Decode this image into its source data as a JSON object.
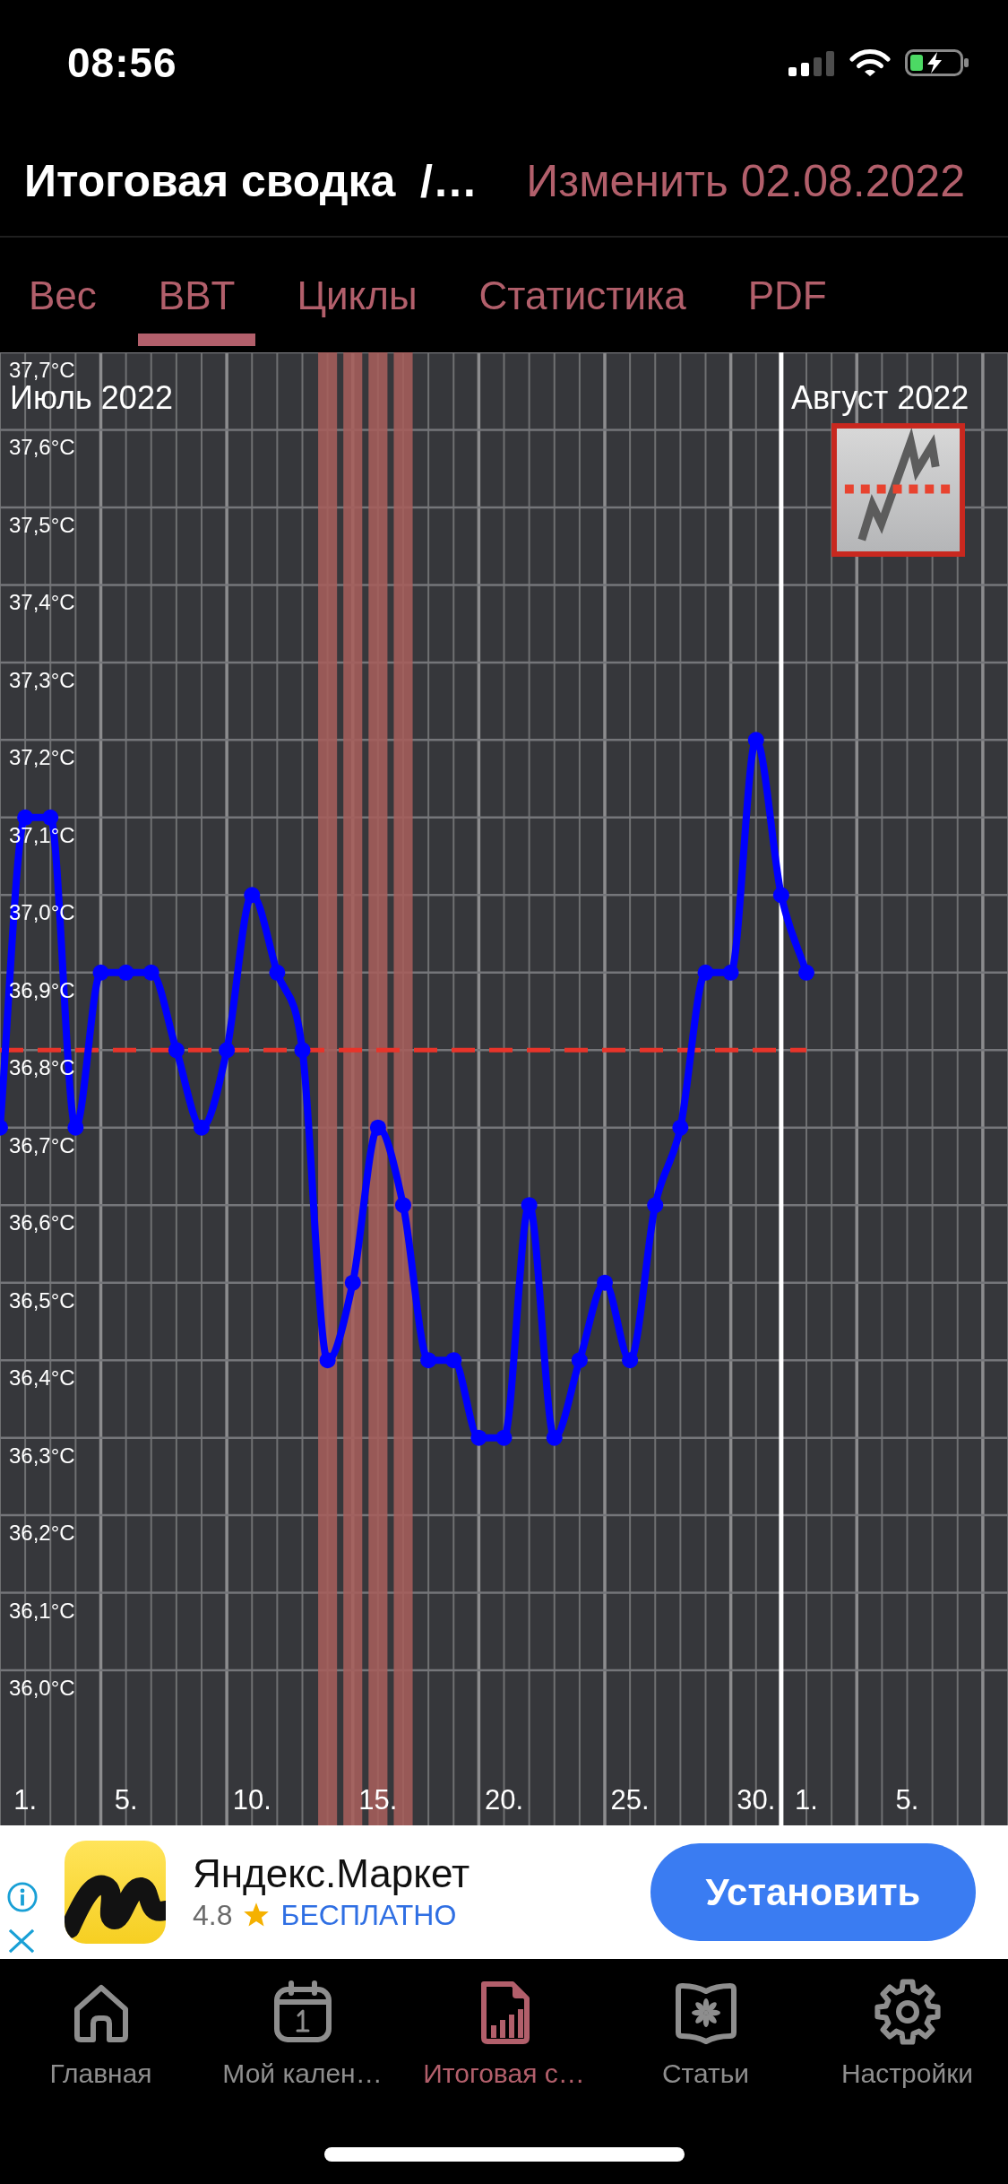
{
  "status_bar": {
    "time": "08:56"
  },
  "header": {
    "title": "Итоговая сводка  /…",
    "action": "Изменить 02.08.2022"
  },
  "tabs": [
    {
      "label": "Вес",
      "selected": false
    },
    {
      "label": "BBT",
      "selected": true
    },
    {
      "label": "Циклы",
      "selected": false
    },
    {
      "label": "Статистика",
      "selected": false
    },
    {
      "label": "PDF",
      "selected": false
    }
  ],
  "chart": {
    "chart_data": {
      "type": "line",
      "grid": true,
      "x": [
        "2022-06-30",
        "2022-07-01",
        "2022-07-02",
        "2022-07-03",
        "2022-07-04",
        "2022-07-05",
        "2022-07-06",
        "2022-07-07",
        "2022-07-08",
        "2022-07-09",
        "2022-07-10",
        "2022-07-11",
        "2022-07-12",
        "2022-07-13",
        "2022-07-14",
        "2022-07-15",
        "2022-07-16",
        "2022-07-17",
        "2022-07-18",
        "2022-07-19",
        "2022-07-20",
        "2022-07-21",
        "2022-07-22",
        "2022-07-23",
        "2022-07-24",
        "2022-07-25",
        "2022-07-26",
        "2022-07-27",
        "2022-07-28",
        "2022-07-29",
        "2022-07-30",
        "2022-07-31",
        "2022-08-01"
      ],
      "series": [
        {
          "color": "#0000ff",
          "marker": "circle",
          "values": [
            36.7,
            37.1,
            37.1,
            36.7,
            36.9,
            36.9,
            36.9,
            36.8,
            36.7,
            36.8,
            37.0,
            36.9,
            36.8,
            36.4,
            36.5,
            36.7,
            36.6,
            36.4,
            36.4,
            36.3,
            36.3,
            36.6,
            36.3,
            36.4,
            36.5,
            36.4,
            36.6,
            36.7,
            36.9,
            36.9,
            37.2,
            37.0,
            36.9
          ]
        }
      ],
      "xlim": [
        "2022-06-30",
        "2022-08-09"
      ],
      "ylim": [
        35.8,
        37.7
      ],
      "xticks": [
        {
          "value": "2022-07-01",
          "label": "1."
        },
        {
          "value": "2022-07-05",
          "label": "5."
        },
        {
          "value": "2022-07-10",
          "label": "10."
        },
        {
          "value": "2022-07-15",
          "label": "15."
        },
        {
          "value": "2022-07-20",
          "label": "20."
        },
        {
          "value": "2022-07-25",
          "label": "25."
        },
        {
          "value": "2022-07-30",
          "label": "30."
        },
        {
          "value": "2022-08-01",
          "label": "1."
        },
        {
          "value": "2022-08-05",
          "label": "5."
        }
      ],
      "yticks": [
        {
          "value": 36.0,
          "label": "36,0°C"
        },
        {
          "value": 36.1,
          "label": "36,1°C"
        },
        {
          "value": 36.2,
          "label": "36,2°C"
        },
        {
          "value": 36.3,
          "label": "36,3°C"
        },
        {
          "value": 36.4,
          "label": "36,4°C"
        },
        {
          "value": 36.5,
          "label": "36,5°C"
        },
        {
          "value": 36.6,
          "label": "36,6°C"
        },
        {
          "value": 36.7,
          "label": "36,7°C"
        },
        {
          "value": 36.8,
          "label": "36,8°C"
        },
        {
          "value": 36.9,
          "label": "36,9°C"
        },
        {
          "value": 37.0,
          "label": "37,0°C"
        },
        {
          "value": 37.1,
          "label": "37,1°C"
        },
        {
          "value": 37.2,
          "label": "37,2°C"
        },
        {
          "value": 37.3,
          "label": "37,3°C"
        },
        {
          "value": 37.4,
          "label": "37,4°C"
        },
        {
          "value": 37.5,
          "label": "37,5°C"
        },
        {
          "value": 37.6,
          "label": "37,6°C"
        },
        {
          "value": 37.7,
          "label": "37,7°C"
        }
      ],
      "bands": [
        {
          "axis": "x",
          "from": "2022-07-12T15:00",
          "to": "2022-07-13T09:00",
          "color": "#a65f5b"
        },
        {
          "axis": "x",
          "from": "2022-07-13T15:00",
          "to": "2022-07-14T09:00",
          "color": "#a65f5b"
        },
        {
          "axis": "x",
          "from": "2022-07-14T15:00",
          "to": "2022-07-15T09:00",
          "color": "#a65f5b"
        },
        {
          "axis": "x",
          "from": "2022-07-15T15:00",
          "to": "2022-07-16T09:00",
          "color": "#a65f5b"
        }
      ],
      "ref_lines": [
        {
          "axis": "y",
          "value": 36.8,
          "color": "#e8342a"
        },
        {
          "axis": "x",
          "value": "2022-07-31",
          "color": "#ffffff"
        }
      ],
      "annotations": [
        "Июль 2022",
        "Август 2022"
      ]
    }
  },
  "ad": {
    "title": "Яндекс.Маркет",
    "rating": "4.8",
    "price": "БЕСПЛАТНО",
    "button": "Установить"
  },
  "tab_bar": [
    {
      "label": "Главная",
      "selected": false
    },
    {
      "label": "Мой кален…",
      "selected": false
    },
    {
      "label": "Итоговая с…",
      "selected": true
    },
    {
      "label": "Статьи",
      "selected": false
    },
    {
      "label": "Настройки",
      "selected": false
    }
  ]
}
